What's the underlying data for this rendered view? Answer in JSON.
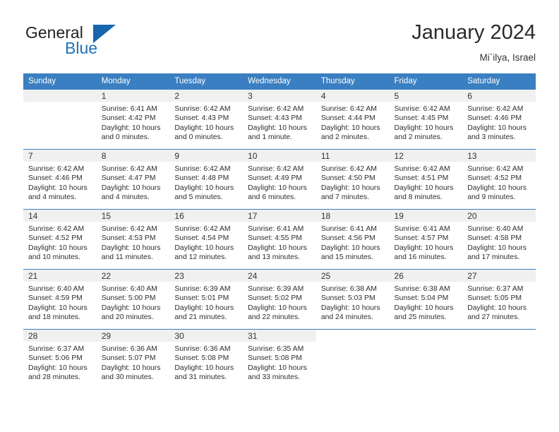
{
  "brand": {
    "line1": "General",
    "line2": "Blue",
    "triangle_color": "#1866ad"
  },
  "header": {
    "title": "January 2024",
    "subtitle": "Mi`ilya, Israel",
    "header_bg": "#3a7fc1",
    "daynum_bg": "#f0f0f0"
  },
  "weekdays": [
    "Sunday",
    "Monday",
    "Tuesday",
    "Wednesday",
    "Thursday",
    "Friday",
    "Saturday"
  ],
  "labels": {
    "sunrise": "Sunrise:",
    "sunset": "Sunset:",
    "daylight": "Daylight:"
  },
  "weeks": [
    [
      {
        "day": "",
        "blank": false,
        "sunrise": "",
        "sunset": "",
        "daylight1": "",
        "daylight2": ""
      },
      {
        "day": "1",
        "sunrise": "Sunrise: 6:41 AM",
        "sunset": "Sunset: 4:42 PM",
        "daylight1": "Daylight: 10 hours",
        "daylight2": "and 0 minutes."
      },
      {
        "day": "2",
        "sunrise": "Sunrise: 6:42 AM",
        "sunset": "Sunset: 4:43 PM",
        "daylight1": "Daylight: 10 hours",
        "daylight2": "and 0 minutes."
      },
      {
        "day": "3",
        "sunrise": "Sunrise: 6:42 AM",
        "sunset": "Sunset: 4:43 PM",
        "daylight1": "Daylight: 10 hours",
        "daylight2": "and 1 minute."
      },
      {
        "day": "4",
        "sunrise": "Sunrise: 6:42 AM",
        "sunset": "Sunset: 4:44 PM",
        "daylight1": "Daylight: 10 hours",
        "daylight2": "and 2 minutes."
      },
      {
        "day": "5",
        "sunrise": "Sunrise: 6:42 AM",
        "sunset": "Sunset: 4:45 PM",
        "daylight1": "Daylight: 10 hours",
        "daylight2": "and 2 minutes."
      },
      {
        "day": "6",
        "sunrise": "Sunrise: 6:42 AM",
        "sunset": "Sunset: 4:46 PM",
        "daylight1": "Daylight: 10 hours",
        "daylight2": "and 3 minutes."
      }
    ],
    [
      {
        "day": "7",
        "sunrise": "Sunrise: 6:42 AM",
        "sunset": "Sunset: 4:46 PM",
        "daylight1": "Daylight: 10 hours",
        "daylight2": "and 4 minutes."
      },
      {
        "day": "8",
        "sunrise": "Sunrise: 6:42 AM",
        "sunset": "Sunset: 4:47 PM",
        "daylight1": "Daylight: 10 hours",
        "daylight2": "and 4 minutes."
      },
      {
        "day": "9",
        "sunrise": "Sunrise: 6:42 AM",
        "sunset": "Sunset: 4:48 PM",
        "daylight1": "Daylight: 10 hours",
        "daylight2": "and 5 minutes."
      },
      {
        "day": "10",
        "sunrise": "Sunrise: 6:42 AM",
        "sunset": "Sunset: 4:49 PM",
        "daylight1": "Daylight: 10 hours",
        "daylight2": "and 6 minutes."
      },
      {
        "day": "11",
        "sunrise": "Sunrise: 6:42 AM",
        "sunset": "Sunset: 4:50 PM",
        "daylight1": "Daylight: 10 hours",
        "daylight2": "and 7 minutes."
      },
      {
        "day": "12",
        "sunrise": "Sunrise: 6:42 AM",
        "sunset": "Sunset: 4:51 PM",
        "daylight1": "Daylight: 10 hours",
        "daylight2": "and 8 minutes."
      },
      {
        "day": "13",
        "sunrise": "Sunrise: 6:42 AM",
        "sunset": "Sunset: 4:52 PM",
        "daylight1": "Daylight: 10 hours",
        "daylight2": "and 9 minutes."
      }
    ],
    [
      {
        "day": "14",
        "sunrise": "Sunrise: 6:42 AM",
        "sunset": "Sunset: 4:52 PM",
        "daylight1": "Daylight: 10 hours",
        "daylight2": "and 10 minutes."
      },
      {
        "day": "15",
        "sunrise": "Sunrise: 6:42 AM",
        "sunset": "Sunset: 4:53 PM",
        "daylight1": "Daylight: 10 hours",
        "daylight2": "and 11 minutes."
      },
      {
        "day": "16",
        "sunrise": "Sunrise: 6:42 AM",
        "sunset": "Sunset: 4:54 PM",
        "daylight1": "Daylight: 10 hours",
        "daylight2": "and 12 minutes."
      },
      {
        "day": "17",
        "sunrise": "Sunrise: 6:41 AM",
        "sunset": "Sunset: 4:55 PM",
        "daylight1": "Daylight: 10 hours",
        "daylight2": "and 13 minutes."
      },
      {
        "day": "18",
        "sunrise": "Sunrise: 6:41 AM",
        "sunset": "Sunset: 4:56 PM",
        "daylight1": "Daylight: 10 hours",
        "daylight2": "and 15 minutes."
      },
      {
        "day": "19",
        "sunrise": "Sunrise: 6:41 AM",
        "sunset": "Sunset: 4:57 PM",
        "daylight1": "Daylight: 10 hours",
        "daylight2": "and 16 minutes."
      },
      {
        "day": "20",
        "sunrise": "Sunrise: 6:40 AM",
        "sunset": "Sunset: 4:58 PM",
        "daylight1": "Daylight: 10 hours",
        "daylight2": "and 17 minutes."
      }
    ],
    [
      {
        "day": "21",
        "sunrise": "Sunrise: 6:40 AM",
        "sunset": "Sunset: 4:59 PM",
        "daylight1": "Daylight: 10 hours",
        "daylight2": "and 18 minutes."
      },
      {
        "day": "22",
        "sunrise": "Sunrise: 6:40 AM",
        "sunset": "Sunset: 5:00 PM",
        "daylight1": "Daylight: 10 hours",
        "daylight2": "and 20 minutes."
      },
      {
        "day": "23",
        "sunrise": "Sunrise: 6:39 AM",
        "sunset": "Sunset: 5:01 PM",
        "daylight1": "Daylight: 10 hours",
        "daylight2": "and 21 minutes."
      },
      {
        "day": "24",
        "sunrise": "Sunrise: 6:39 AM",
        "sunset": "Sunset: 5:02 PM",
        "daylight1": "Daylight: 10 hours",
        "daylight2": "and 22 minutes."
      },
      {
        "day": "25",
        "sunrise": "Sunrise: 6:38 AM",
        "sunset": "Sunset: 5:03 PM",
        "daylight1": "Daylight: 10 hours",
        "daylight2": "and 24 minutes."
      },
      {
        "day": "26",
        "sunrise": "Sunrise: 6:38 AM",
        "sunset": "Sunset: 5:04 PM",
        "daylight1": "Daylight: 10 hours",
        "daylight2": "and 25 minutes."
      },
      {
        "day": "27",
        "sunrise": "Sunrise: 6:37 AM",
        "sunset": "Sunset: 5:05 PM",
        "daylight1": "Daylight: 10 hours",
        "daylight2": "and 27 minutes."
      }
    ],
    [
      {
        "day": "28",
        "sunrise": "Sunrise: 6:37 AM",
        "sunset": "Sunset: 5:06 PM",
        "daylight1": "Daylight: 10 hours",
        "daylight2": "and 28 minutes."
      },
      {
        "day": "29",
        "sunrise": "Sunrise: 6:36 AM",
        "sunset": "Sunset: 5:07 PM",
        "daylight1": "Daylight: 10 hours",
        "daylight2": "and 30 minutes."
      },
      {
        "day": "30",
        "sunrise": "Sunrise: 6:36 AM",
        "sunset": "Sunset: 5:08 PM",
        "daylight1": "Daylight: 10 hours",
        "daylight2": "and 31 minutes."
      },
      {
        "day": "31",
        "sunrise": "Sunrise: 6:35 AM",
        "sunset": "Sunset: 5:08 PM",
        "daylight1": "Daylight: 10 hours",
        "daylight2": "and 33 minutes."
      },
      {
        "day": "",
        "blank": true,
        "sunrise": "",
        "sunset": "",
        "daylight1": "",
        "daylight2": ""
      },
      {
        "day": "",
        "blank": true,
        "sunrise": "",
        "sunset": "",
        "daylight1": "",
        "daylight2": ""
      },
      {
        "day": "",
        "blank": true,
        "sunrise": "",
        "sunset": "",
        "daylight1": "",
        "daylight2": ""
      }
    ]
  ]
}
